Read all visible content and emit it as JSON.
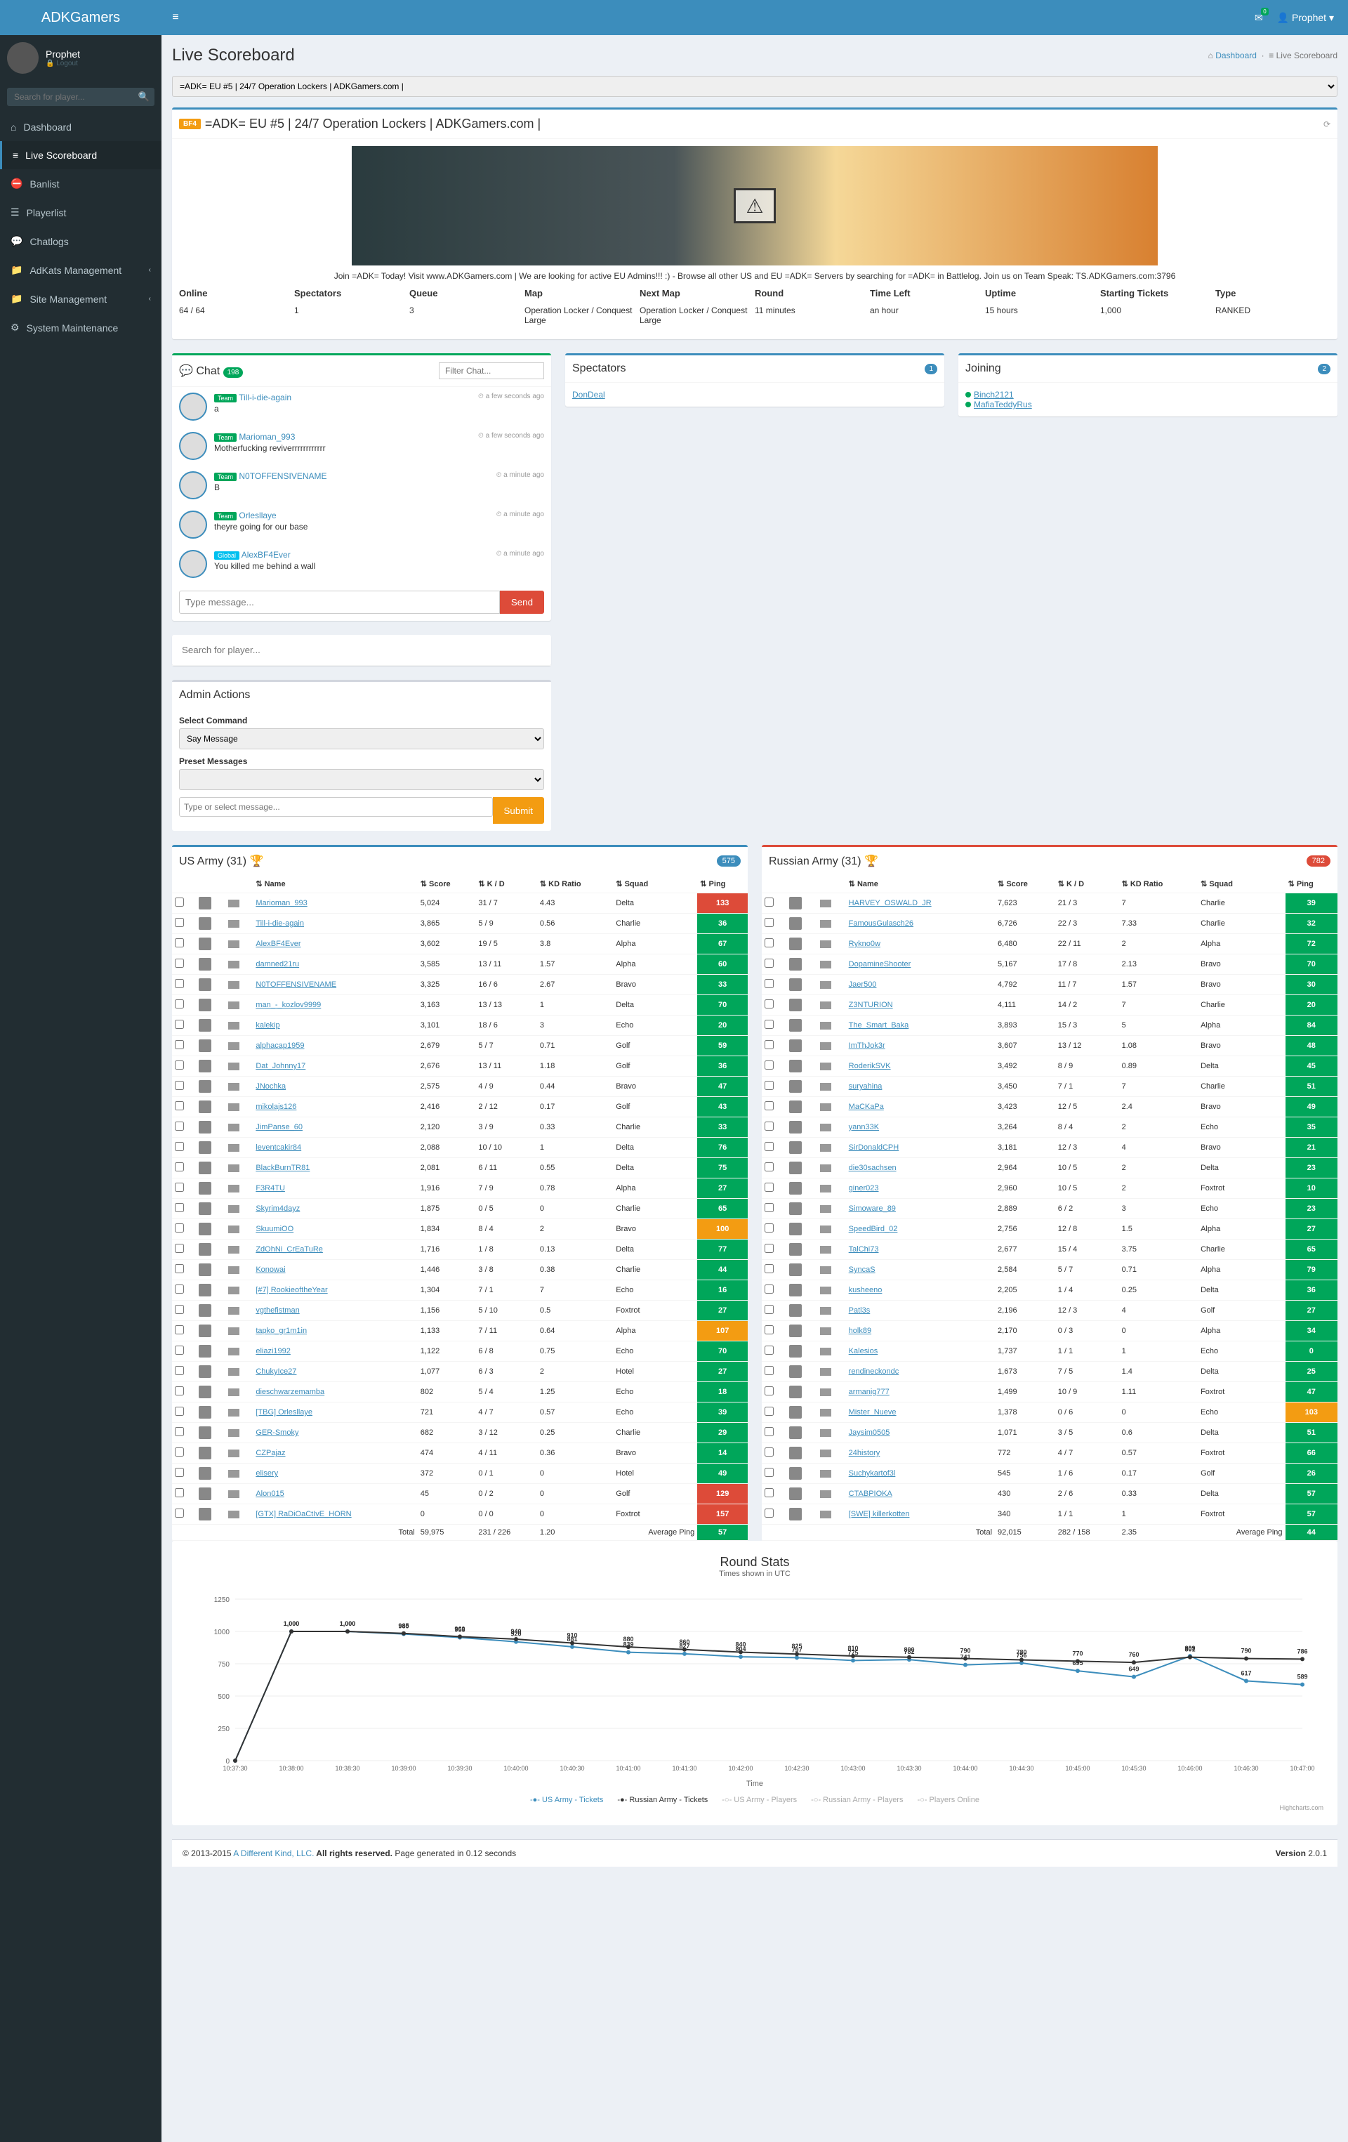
{
  "app": {
    "brand": "ADKGamers",
    "user": "Prophet",
    "logout": "Logout",
    "envCount": "0",
    "search_ph": "Search for player..."
  },
  "nav": [
    {
      "icon": "⌂",
      "label": "Dashboard"
    },
    {
      "icon": "≡",
      "label": "Live Scoreboard",
      "active": true
    },
    {
      "icon": "⛔",
      "label": "Banlist"
    },
    {
      "icon": "☰",
      "label": "Playerlist"
    },
    {
      "icon": "💬",
      "label": "Chatlogs"
    },
    {
      "icon": "📁",
      "label": "AdKats Management",
      "arrow": true
    },
    {
      "icon": "📁",
      "label": "Site Management",
      "arrow": true
    },
    {
      "icon": "⚙",
      "label": "System Maintenance"
    }
  ],
  "page": {
    "title": "Live Scoreboard",
    "bc_dash": "Dashboard",
    "bc_live": "Live Scoreboard",
    "bc_icon": "⌂"
  },
  "server": {
    "select": "=ADK= EU #5 | 24/7 Operation Lockers | ADKGamers.com |",
    "tag": "BF4",
    "title": "=ADK= EU #5 | 24/7 Operation Lockers | ADKGamers.com |",
    "tagline": "Join =ADK= Today! Visit www.ADKGamers.com | We are looking for active EU Admins!!! :) - Browse all other US and EU =ADK= Servers by searching for =ADK= in Battlelog. Join us on Team Speak: TS.ADKGamers.com:3796",
    "stats": [
      {
        "k": "Online",
        "v": "64 / 64"
      },
      {
        "k": "Spectators",
        "v": "1"
      },
      {
        "k": "Queue",
        "v": "3"
      },
      {
        "k": "Map",
        "v": "Operation Locker / Conquest Large"
      },
      {
        "k": "Next Map",
        "v": "Operation Locker / Conquest Large"
      },
      {
        "k": "Round",
        "v": "11 minutes"
      },
      {
        "k": "Time Left",
        "v": "an hour"
      },
      {
        "k": "Uptime",
        "v": "15 hours"
      },
      {
        "k": "Starting Tickets",
        "v": "1,000"
      },
      {
        "k": "Type",
        "v": "RANKED"
      }
    ]
  },
  "chat": {
    "title": "Chat",
    "count": "198",
    "filter_ph": "Filter Chat...",
    "type_ph": "Type message...",
    "send": "Send",
    "items": [
      {
        "tag": "Team",
        "name": "Till-i-die-again",
        "msg": "a",
        "time": "a few seconds ago"
      },
      {
        "tag": "Team",
        "name": "Marioman_993",
        "msg": "Motherfucking reviverrrrrrrrrrrr",
        "time": "a few seconds ago"
      },
      {
        "tag": "Team",
        "name": "N0TOFFENSIVENAME",
        "msg": "B",
        "time": "a minute ago"
      },
      {
        "tag": "Team",
        "name": "Orlesllaye",
        "msg": "theyre going for our base",
        "time": "a minute ago"
      },
      {
        "tag": "Global",
        "name": "AlexBF4Ever",
        "msg": "You killed me behind a wall",
        "time": "a minute ago"
      }
    ]
  },
  "spectators": {
    "title": "Spectators",
    "count": "1",
    "list": [
      "DonDeal"
    ]
  },
  "joining": {
    "title": "Joining",
    "count": "2",
    "list": [
      "Binch2121",
      "MafiaTeddyRus"
    ]
  },
  "admin": {
    "title": "Admin Actions",
    "sel_cmd_lbl": "Select Command",
    "sel_cmd": "Say Message",
    "preset_lbl": "Preset Messages",
    "type_ph": "Type or select message...",
    "submit": "Submit",
    "search_ph": "Search for player..."
  },
  "teams": {
    "us": {
      "title": "US Army (31)",
      "badge": "575",
      "rows": [
        [
          "Marioman_993",
          "5,024",
          "31 / 7",
          "4.43",
          "Delta",
          "133",
          "r"
        ],
        [
          "Till-i-die-again",
          "3,865",
          "5 / 9",
          "0.56",
          "Charlie",
          "36",
          "g"
        ],
        [
          "AlexBF4Ever",
          "3,602",
          "19 / 5",
          "3.8",
          "Alpha",
          "67",
          "g"
        ],
        [
          "damned21ru",
          "3,585",
          "13 / 11",
          "1.57",
          "Alpha",
          "60",
          "g"
        ],
        [
          "N0TOFFENSIVENAME",
          "3,325",
          "16 / 6",
          "2.67",
          "Bravo",
          "33",
          "g"
        ],
        [
          "man_-_kozlov9999",
          "3,163",
          "13 / 13",
          "1",
          "Delta",
          "70",
          "g"
        ],
        [
          "kalekip",
          "3,101",
          "18 / 6",
          "3",
          "Echo",
          "20",
          "g"
        ],
        [
          "alphacap1959",
          "2,679",
          "5 / 7",
          "0.71",
          "Golf",
          "59",
          "g"
        ],
        [
          "Dat_Johnny17",
          "2,676",
          "13 / 11",
          "1.18",
          "Golf",
          "36",
          "g"
        ],
        [
          "JNochka",
          "2,575",
          "4 / 9",
          "0.44",
          "Bravo",
          "47",
          "g"
        ],
        [
          "mikolajs126",
          "2,416",
          "2 / 12",
          "0.17",
          "Golf",
          "43",
          "g"
        ],
        [
          "JimPanse_60",
          "2,120",
          "3 / 9",
          "0.33",
          "Charlie",
          "33",
          "g"
        ],
        [
          "leventcakir84",
          "2,088",
          "10 / 10",
          "1",
          "Delta",
          "76",
          "g"
        ],
        [
          "BlackBurnTR81",
          "2,081",
          "6 / 11",
          "0.55",
          "Delta",
          "75",
          "g"
        ],
        [
          "F3R4TU",
          "1,916",
          "7 / 9",
          "0.78",
          "Alpha",
          "27",
          "g"
        ],
        [
          "Skyrim4dayz",
          "1,875",
          "0 / 5",
          "0",
          "Charlie",
          "65",
          "g"
        ],
        [
          "SkuumiOO",
          "1,834",
          "8 / 4",
          "2",
          "Bravo",
          "100",
          "o"
        ],
        [
          "ZdOhNi_CrEaTuRe",
          "1,716",
          "1 / 8",
          "0.13",
          "Delta",
          "77",
          "g"
        ],
        [
          "Konowai",
          "1,446",
          "3 / 8",
          "0.38",
          "Charlie",
          "44",
          "g"
        ],
        [
          "[#7] RookieoftheYear",
          "1,304",
          "7 / 1",
          "7",
          "Echo",
          "16",
          "g"
        ],
        [
          "vgthefistman",
          "1,156",
          "5 / 10",
          "0.5",
          "Foxtrot",
          "27",
          "g"
        ],
        [
          "tapko_gr1m1in",
          "1,133",
          "7 / 11",
          "0.64",
          "Alpha",
          "107",
          "o"
        ],
        [
          "eliazi1992",
          "1,122",
          "6 / 8",
          "0.75",
          "Echo",
          "70",
          "g"
        ],
        [
          "ChukyIce27",
          "1,077",
          "6 / 3",
          "2",
          "Hotel",
          "27",
          "g"
        ],
        [
          "dieschwarzemamba",
          "802",
          "5 / 4",
          "1.25",
          "Echo",
          "18",
          "g"
        ],
        [
          "[TBG] Orlesllaye",
          "721",
          "4 / 7",
          "0.57",
          "Echo",
          "39",
          "g"
        ],
        [
          "GER-Smoky",
          "682",
          "3 / 12",
          "0.25",
          "Charlie",
          "29",
          "g"
        ],
        [
          "CZPajaz",
          "474",
          "4 / 11",
          "0.36",
          "Bravo",
          "14",
          "g"
        ],
        [
          "elisery",
          "372",
          "0 / 1",
          "0",
          "Hotel",
          "49",
          "g"
        ],
        [
          "Alon015",
          "45",
          "0 / 2",
          "0",
          "Golf",
          "129",
          "r"
        ],
        [
          "[GTX] RaDiOaCtIvE_HORN",
          "0",
          "0 / 0",
          "0",
          "Foxtrot",
          "157",
          "r"
        ]
      ],
      "total": [
        "Total",
        "59,975",
        "231 / 226",
        "1.20",
        "Average Ping",
        "57"
      ]
    },
    "ru": {
      "title": "Russian Army (31)",
      "badge": "782",
      "rows": [
        [
          "HARVEY_OSWALD_JR",
          "7,623",
          "21 / 3",
          "7",
          "Charlie",
          "39",
          "g"
        ],
        [
          "FamousGulasch26",
          "6,726",
          "22 / 3",
          "7.33",
          "Charlie",
          "32",
          "g"
        ],
        [
          "Rykno0w",
          "6,480",
          "22 / 11",
          "2",
          "Alpha",
          "72",
          "g"
        ],
        [
          "DopamineShooter",
          "5,167",
          "17 / 8",
          "2.13",
          "Bravo",
          "70",
          "g"
        ],
        [
          "Jaer500",
          "4,792",
          "11 / 7",
          "1.57",
          "Bravo",
          "30",
          "g"
        ],
        [
          "Z3NTURION",
          "4,111",
          "14 / 2",
          "7",
          "Charlie",
          "20",
          "g"
        ],
        [
          "The_Smart_Baka",
          "3,893",
          "15 / 3",
          "5",
          "Alpha",
          "84",
          "g"
        ],
        [
          "ImThJok3r",
          "3,607",
          "13 / 12",
          "1.08",
          "Bravo",
          "48",
          "g"
        ],
        [
          "RoderikSVK",
          "3,492",
          "8 / 9",
          "0.89",
          "Delta",
          "45",
          "g"
        ],
        [
          "suryahina",
          "3,450",
          "7 / 1",
          "7",
          "Charlie",
          "51",
          "g"
        ],
        [
          "MaCKaPa",
          "3,423",
          "12 / 5",
          "2.4",
          "Bravo",
          "49",
          "g"
        ],
        [
          "yann33K",
          "3,264",
          "8 / 4",
          "2",
          "Echo",
          "35",
          "g"
        ],
        [
          "SirDonaldCPH",
          "3,181",
          "12 / 3",
          "4",
          "Bravo",
          "21",
          "g"
        ],
        [
          "die30sachsen",
          "2,964",
          "10 / 5",
          "2",
          "Delta",
          "23",
          "g"
        ],
        [
          "giner023",
          "2,960",
          "10 / 5",
          "2",
          "Foxtrot",
          "10",
          "g"
        ],
        [
          "Simoware_89",
          "2,889",
          "6 / 2",
          "3",
          "Echo",
          "23",
          "g"
        ],
        [
          "SpeedBird_02",
          "2,756",
          "12 / 8",
          "1.5",
          "Alpha",
          "27",
          "g"
        ],
        [
          "TalChi73",
          "2,677",
          "15 / 4",
          "3.75",
          "Charlie",
          "65",
          "g"
        ],
        [
          "SyncaS",
          "2,584",
          "5 / 7",
          "0.71",
          "Alpha",
          "79",
          "g"
        ],
        [
          "kusheeno",
          "2,205",
          "1 / 4",
          "0.25",
          "Delta",
          "36",
          "g"
        ],
        [
          "Patl3s",
          "2,196",
          "12 / 3",
          "4",
          "Golf",
          "27",
          "g"
        ],
        [
          "holk89",
          "2,170",
          "0 / 3",
          "0",
          "Alpha",
          "34",
          "g"
        ],
        [
          "Kalesios",
          "1,737",
          "1 / 1",
          "1",
          "Echo",
          "0",
          "g"
        ],
        [
          "rendineckondc",
          "1,673",
          "7 / 5",
          "1.4",
          "Delta",
          "25",
          "g"
        ],
        [
          "armanig777",
          "1,499",
          "10 / 9",
          "1.11",
          "Foxtrot",
          "47",
          "g"
        ],
        [
          "Mister_Nueve",
          "1,378",
          "0 / 6",
          "0",
          "Echo",
          "103",
          "o"
        ],
        [
          "Jaysim0505",
          "1,071",
          "3 / 5",
          "0.6",
          "Delta",
          "51",
          "g"
        ],
        [
          "24history",
          "772",
          "4 / 7",
          "0.57",
          "Foxtrot",
          "66",
          "g"
        ],
        [
          "Suchykartof3l",
          "545",
          "1 / 6",
          "0.17",
          "Golf",
          "26",
          "g"
        ],
        [
          "CTABPIOKA",
          "430",
          "2 / 6",
          "0.33",
          "Delta",
          "57",
          "g"
        ],
        [
          "[SWE] killerkotten",
          "340",
          "1 / 1",
          "1",
          "Foxtrot",
          "57",
          "g"
        ]
      ],
      "total": [
        "Total",
        "92,015",
        "282 / 158",
        "2.35",
        "Average Ping",
        "44"
      ]
    }
  },
  "headers": [
    "",
    "",
    "",
    "Name",
    "Score",
    "K / D",
    "KD Ratio",
    "Squad",
    "Ping"
  ],
  "chart_data": {
    "type": "line",
    "title": "Round Stats",
    "subtitle": "Times shown in UTC",
    "xlabel": "Time",
    "ylabel": "",
    "ylim": [
      0,
      1250
    ],
    "x": [
      "10:37:30",
      "10:38:00",
      "10:38:30",
      "10:39:00",
      "10:39:30",
      "10:40:00",
      "10:40:30",
      "10:41:00",
      "10:41:30",
      "10:42:00",
      "10:42:30",
      "10:43:00",
      "10:43:30",
      "10:44:00",
      "10:44:30",
      "10:45:00",
      "10:45:30",
      "10:46:00",
      "10:46:30",
      "10:47:00"
    ],
    "series": [
      {
        "name": "US Army - Tickets",
        "color": "#3c8dbc",
        "values": [
          0,
          1000,
          1000,
          980,
          953,
          920,
          881,
          839,
          827,
          804,
          797,
          775,
          782,
          741,
          756,
          695,
          649,
          809,
          617,
          589
        ]
      },
      {
        "name": "Russian Army - Tickets",
        "color": "#333",
        "values": [
          0,
          1000,
          1000,
          985,
          960,
          940,
          910,
          880,
          860,
          840,
          825,
          810,
          800,
          790,
          780,
          770,
          760,
          801,
          790,
          786
        ]
      },
      {
        "name": "US Army - Players",
        "color": "#aaa",
        "values": null
      },
      {
        "name": "Russian Army - Players",
        "color": "#aaa",
        "values": null
      },
      {
        "name": "Players Online",
        "color": "#aaa",
        "values": null
      }
    ],
    "credits": "Highcharts.com"
  },
  "footer": {
    "copy": "© 2013-2015 ",
    "brand": "A Different Kind, LLC.",
    "rights": " All rights reserved. ",
    "gen": "Page generated in 0.12 seconds",
    "ver_lbl": "Version ",
    "ver": "2.0.1"
  }
}
